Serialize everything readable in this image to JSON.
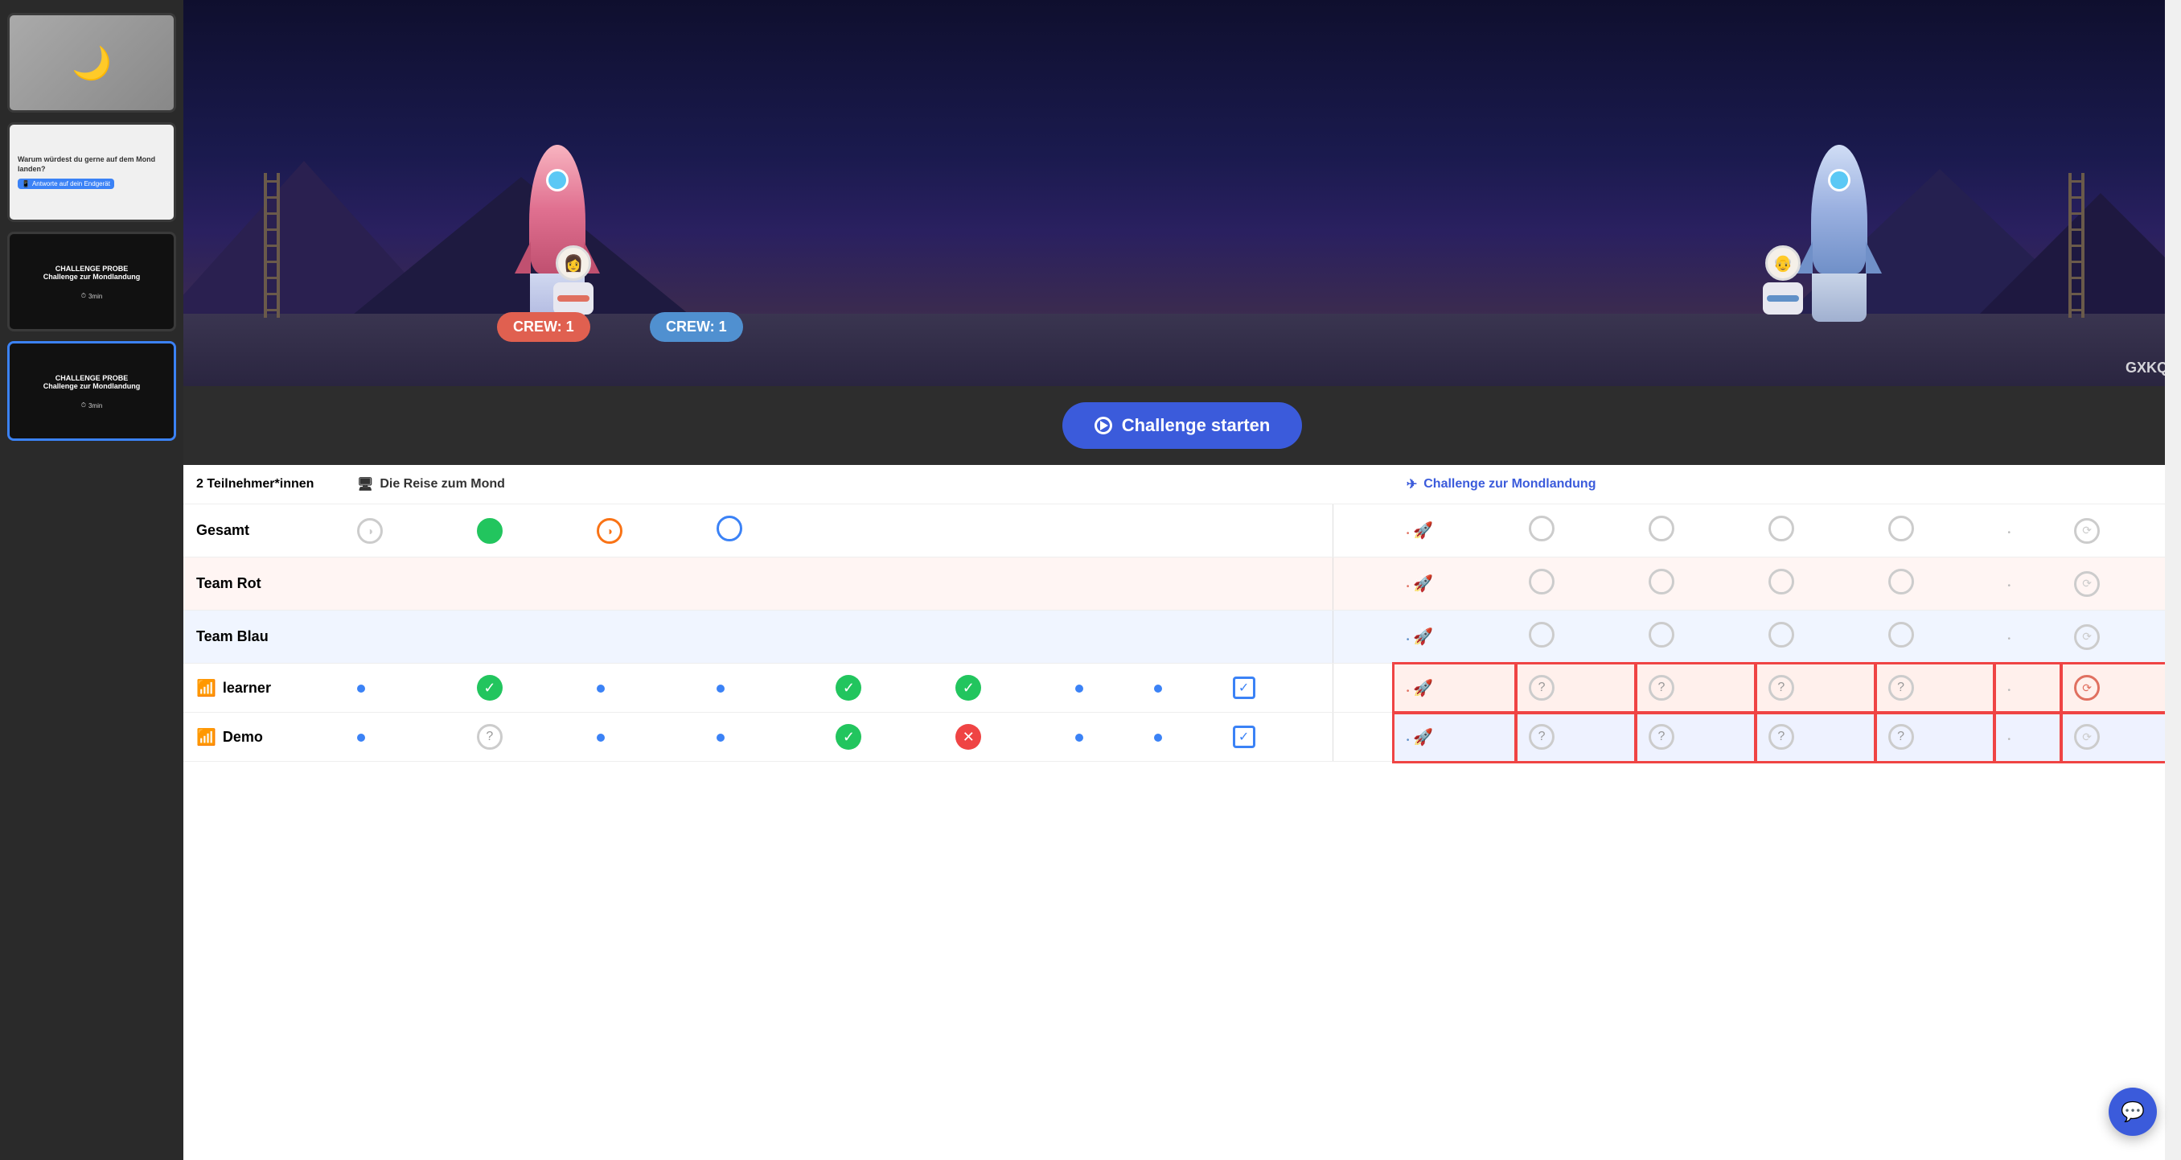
{
  "sidebar": {
    "slides": [
      {
        "id": 1,
        "type": "moon",
        "label": ""
      },
      {
        "id": 2,
        "type": "question",
        "title": "Warum würdest du gerne auf dem Mond landen?",
        "icon_text": "Antworte auf dein Endgerät"
      },
      {
        "id": 3,
        "type": "challenge_dark",
        "title": "Challenge zur Mondlandung",
        "duration": "3min",
        "active": false
      },
      {
        "id": 4,
        "type": "challenge_dark",
        "title": "Challenge zur Mondlandung",
        "duration": "3min",
        "active": true
      }
    ]
  },
  "game": {
    "crew_left_label": "CREW: 1",
    "crew_right_label": "CREW: 1",
    "code": "GXKQ",
    "astronaut_left_emoji": "👩‍🚀",
    "astronaut_right_emoji": "👨‍🚀"
  },
  "challenge_button": {
    "label": "Challenge starten"
  },
  "table": {
    "participants_label": "2 Teilnehmer*innen",
    "section1_label": "Die Reise zum Mond",
    "section2_label": "Challenge zur Mondlandung",
    "monitor_icon": "🖥",
    "rocket_icon": "🚀",
    "rows": [
      {
        "name": "Gesamt",
        "type": "total",
        "cells1": [
          "circle_gray_half",
          "circle_green_full",
          "circle_orange_half",
          "circle_blue_outline"
        ],
        "cells2_prefix": "rocket_orange",
        "cells2": [
          "circle_gray",
          "circle_gray",
          "circle_gray",
          "circle_gray",
          "dot_gray",
          "circle_gray_timer"
        ],
        "wifi": false
      },
      {
        "name": "Team Rot",
        "type": "team_rot",
        "cells1": [],
        "cells2_prefix": "rocket_orange",
        "cells2": [
          "circle_gray",
          "circle_gray",
          "circle_gray",
          "circle_gray",
          "dot_gray",
          "circle_gray_timer"
        ],
        "wifi": false
      },
      {
        "name": "Team Blau",
        "type": "team_blau",
        "cells1": [],
        "cells2_prefix": "rocket_blue",
        "cells2": [
          "circle_gray",
          "circle_gray",
          "circle_gray",
          "circle_gray",
          "dot_gray",
          "circle_gray_timer"
        ],
        "wifi": false
      },
      {
        "name": "learner",
        "type": "learner",
        "cells1": [
          "dot_blue",
          "check_green",
          "dot_blue",
          "dot_blue",
          "check_green",
          "check_green",
          "dot_blue",
          "dot_blue",
          "checkbox_blue"
        ],
        "cells2_prefix": "rocket_orange",
        "cells2": [
          "question",
          "question",
          "question",
          "question",
          "dot_gray",
          "circle_orange_timer"
        ],
        "wifi": true,
        "highlighted": true
      },
      {
        "name": "Demo",
        "type": "demo",
        "cells1": [
          "dot_blue",
          "question_circle",
          "dot_blue",
          "dot_blue",
          "check_green",
          "x_red",
          "dot_blue",
          "dot_blue",
          "checkbox_blue"
        ],
        "cells2_prefix": "rocket_blue",
        "cells2": [
          "question",
          "question",
          "question",
          "question",
          "dot_gray",
          "circle_gray_timer"
        ],
        "wifi": true,
        "highlighted": true
      }
    ]
  },
  "chat_button": {
    "icon": "💬"
  }
}
